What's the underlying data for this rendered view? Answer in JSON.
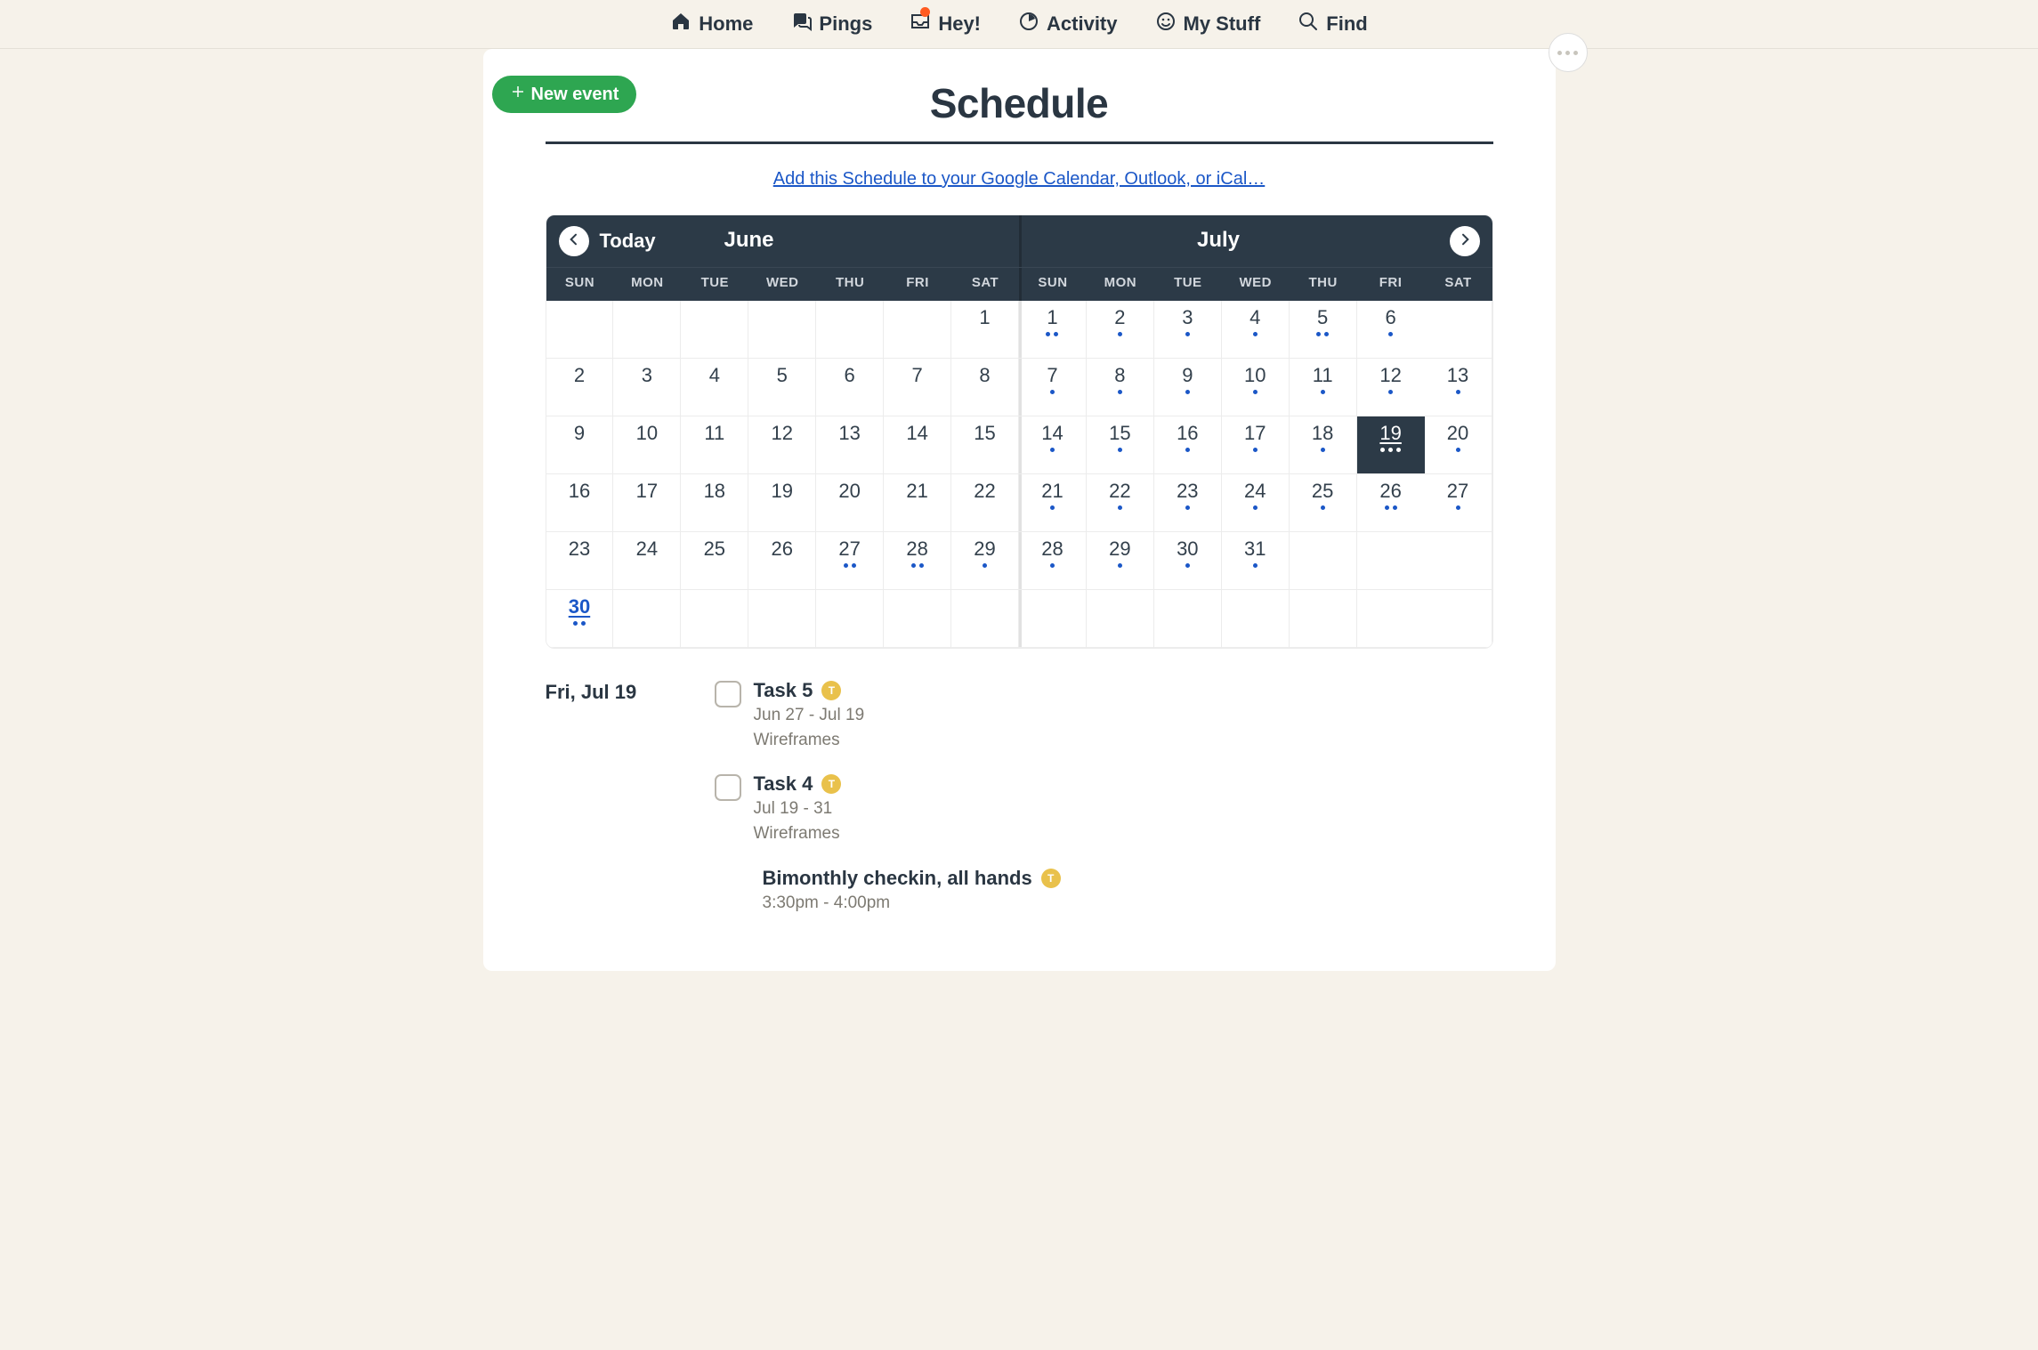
{
  "nav": {
    "home": "Home",
    "pings": "Pings",
    "hey": "Hey!",
    "activity": "Activity",
    "mystuff": "My Stuff",
    "find": "Find"
  },
  "header": {
    "new_event": "New event",
    "title": "Schedule",
    "add_link": "Add this Schedule to your Google Calendar, Outlook, or iCal…"
  },
  "calendar": {
    "today_label": "Today",
    "month1": "June",
    "month2": "July",
    "dow": [
      "SUN",
      "MON",
      "TUE",
      "WED",
      "THU",
      "FRI",
      "SAT",
      "SUN",
      "MON",
      "TUE",
      "WED",
      "THU",
      "FRI",
      "SAT"
    ],
    "rows": [
      [
        {
          "n": ""
        },
        {
          "n": ""
        },
        {
          "n": ""
        },
        {
          "n": ""
        },
        {
          "n": ""
        },
        {
          "n": ""
        },
        {
          "n": "1"
        },
        {
          "n": "1",
          "d": 2
        },
        {
          "n": "2",
          "d": 1
        },
        {
          "n": "3",
          "d": 1
        },
        {
          "n": "4",
          "d": 1
        },
        {
          "n": "5",
          "d": 2
        },
        {
          "n": "6",
          "d": 1
        },
        {
          "n": ""
        }
      ],
      [
        {
          "n": "2"
        },
        {
          "n": "3"
        },
        {
          "n": "4"
        },
        {
          "n": "5"
        },
        {
          "n": "6"
        },
        {
          "n": "7"
        },
        {
          "n": "8"
        },
        {
          "n": "7",
          "d": 1
        },
        {
          "n": "8",
          "d": 1
        },
        {
          "n": "9",
          "d": 1
        },
        {
          "n": "10",
          "d": 1
        },
        {
          "n": "11",
          "d": 1
        },
        {
          "n": "12",
          "d": 1
        },
        {
          "n": "13",
          "d": 1
        }
      ],
      [
        {
          "n": "9"
        },
        {
          "n": "10"
        },
        {
          "n": "11"
        },
        {
          "n": "12"
        },
        {
          "n": "13"
        },
        {
          "n": "14"
        },
        {
          "n": "15"
        },
        {
          "n": "14",
          "d": 1
        },
        {
          "n": "15",
          "d": 1
        },
        {
          "n": "16",
          "d": 1
        },
        {
          "n": "17",
          "d": 1
        },
        {
          "n": "18",
          "d": 1
        },
        {
          "n": "19",
          "d": 3,
          "sel": true
        },
        {
          "n": "20",
          "d": 1
        }
      ],
      [
        {
          "n": "16"
        },
        {
          "n": "17"
        },
        {
          "n": "18"
        },
        {
          "n": "19"
        },
        {
          "n": "20"
        },
        {
          "n": "21"
        },
        {
          "n": "22"
        },
        {
          "n": "21",
          "d": 1
        },
        {
          "n": "22",
          "d": 1
        },
        {
          "n": "23",
          "d": 1
        },
        {
          "n": "24",
          "d": 1
        },
        {
          "n": "25",
          "d": 1
        },
        {
          "n": "26",
          "d": 2
        },
        {
          "n": "27",
          "d": 1
        }
      ],
      [
        {
          "n": "23"
        },
        {
          "n": "24"
        },
        {
          "n": "25"
        },
        {
          "n": "26"
        },
        {
          "n": "27",
          "d": 2
        },
        {
          "n": "28",
          "d": 2
        },
        {
          "n": "29",
          "d": 1
        },
        {
          "n": "28",
          "d": 1
        },
        {
          "n": "29",
          "d": 1
        },
        {
          "n": "30",
          "d": 1
        },
        {
          "n": "31",
          "d": 1
        },
        {
          "n": ""
        },
        {
          "n": ""
        },
        {
          "n": ""
        }
      ],
      [
        {
          "n": "30",
          "today": true,
          "d": 2
        },
        {
          "n": ""
        },
        {
          "n": ""
        },
        {
          "n": ""
        },
        {
          "n": ""
        },
        {
          "n": ""
        },
        {
          "n": ""
        },
        {
          "n": ""
        },
        {
          "n": ""
        },
        {
          "n": ""
        },
        {
          "n": ""
        },
        {
          "n": ""
        },
        {
          "n": ""
        },
        {
          "n": ""
        }
      ]
    ]
  },
  "agenda": {
    "date": "Fri, Jul 19",
    "badge_letter": "T",
    "items": [
      {
        "title": "Task 5",
        "sub1": "Jun 27 - Jul 19",
        "sub2": "Wireframes",
        "checkbox": true,
        "badge": true
      },
      {
        "title": "Task 4",
        "sub1": "Jul 19 - 31",
        "sub2": "Wireframes",
        "checkbox": true,
        "badge": true
      },
      {
        "title": "Bimonthly checkin, all hands",
        "sub1": "3:30pm - 4:00pm",
        "sub2": "",
        "checkbox": false,
        "badge": true
      }
    ]
  }
}
